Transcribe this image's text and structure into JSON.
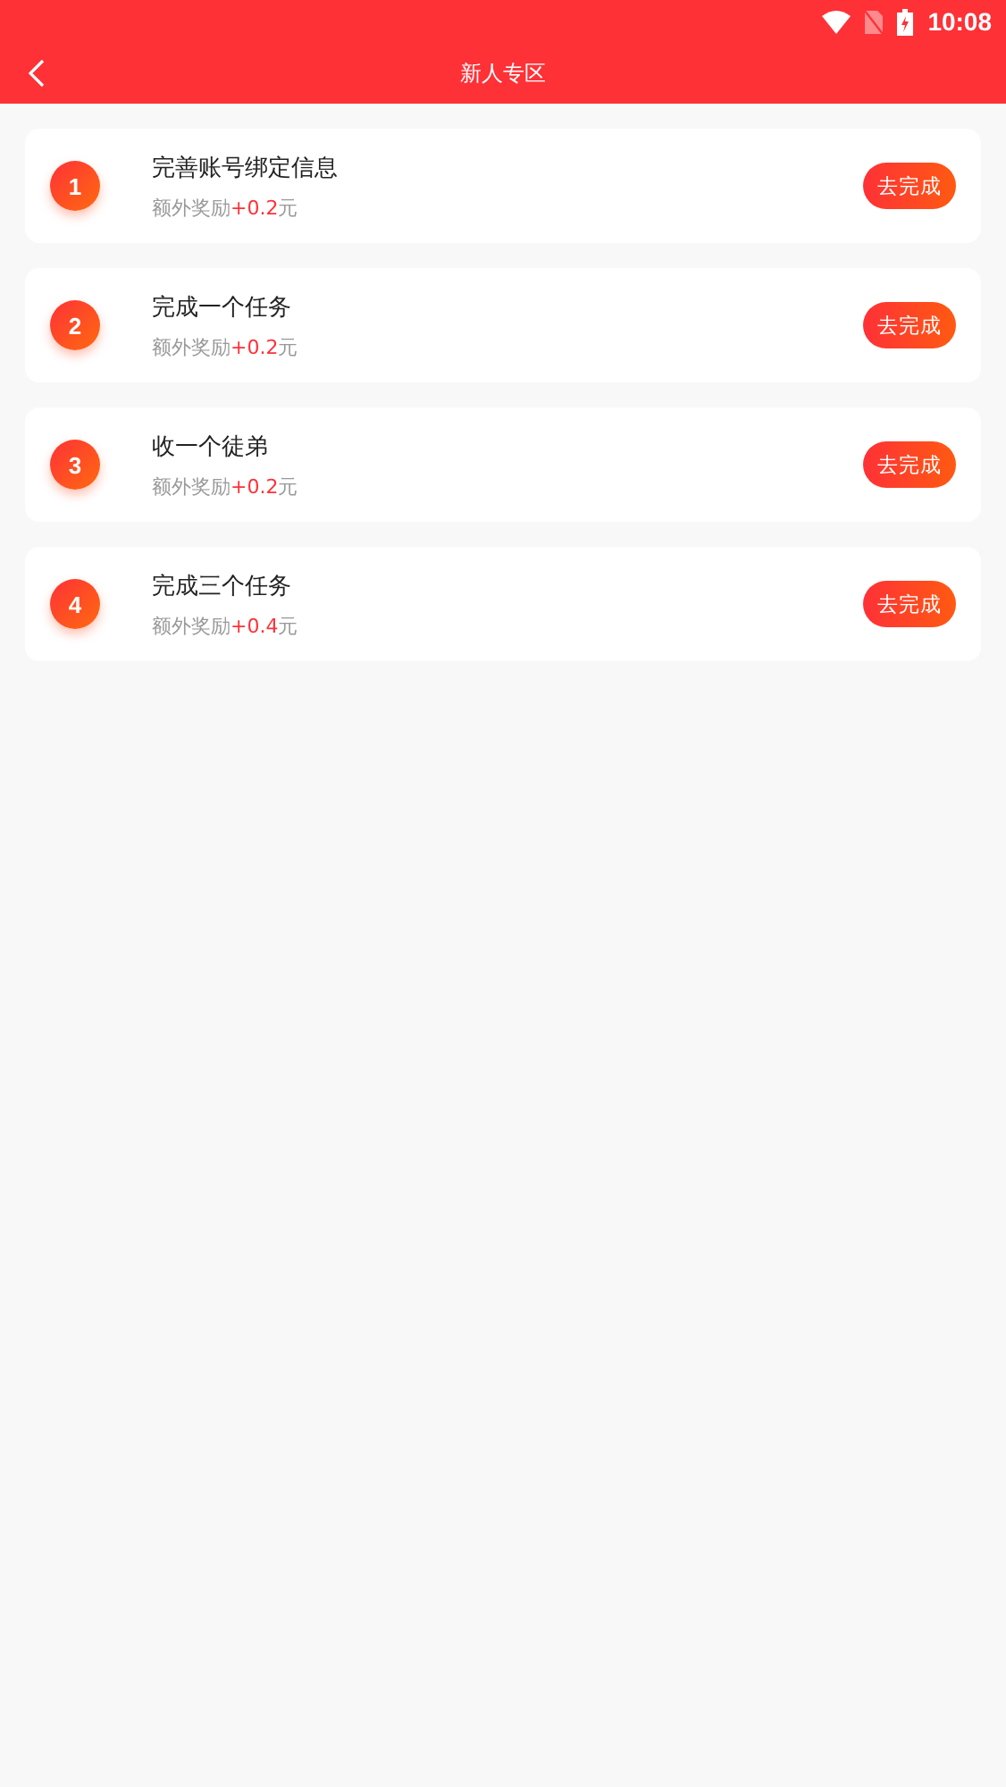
{
  "status_bar": {
    "time": "10:08"
  },
  "nav": {
    "title": "新人专区"
  },
  "tasks": [
    {
      "number": "1",
      "title": "完善账号绑定信息",
      "reward_label": "额外奖励",
      "reward_amount": "+0.2",
      "reward_unit": "元",
      "button": "去完成"
    },
    {
      "number": "2",
      "title": "完成一个任务",
      "reward_label": "额外奖励",
      "reward_amount": "+0.2",
      "reward_unit": "元",
      "button": "去完成"
    },
    {
      "number": "3",
      "title": "收一个徒弟",
      "reward_label": "额外奖励",
      "reward_amount": "+0.2",
      "reward_unit": "元",
      "button": "去完成"
    },
    {
      "number": "4",
      "title": "完成三个任务",
      "reward_label": "额外奖励",
      "reward_amount": "+0.4",
      "reward_unit": "元",
      "button": "去完成"
    }
  ]
}
